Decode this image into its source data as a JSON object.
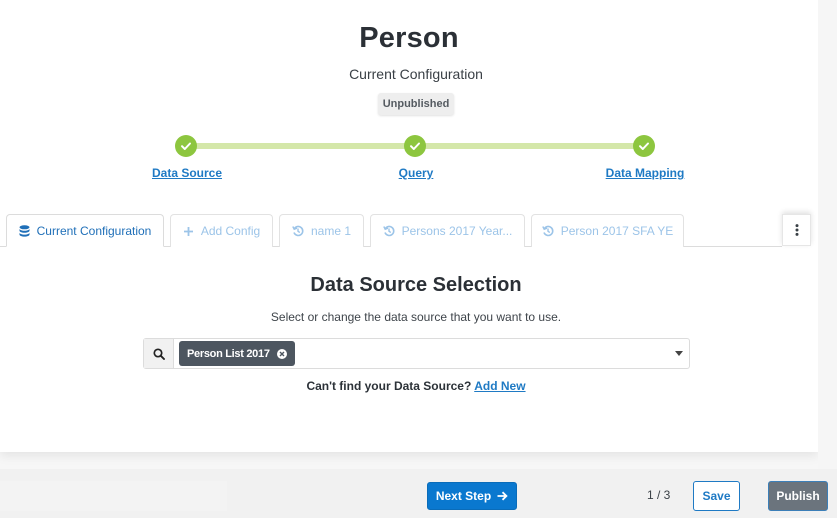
{
  "header": {
    "title": "Person",
    "subtitle": "Current Configuration",
    "status_badge": "Unpublished"
  },
  "stepper": {
    "color_complete": "#8dc63f",
    "steps": [
      {
        "label": "Data Source",
        "status": "complete"
      },
      {
        "label": "Query",
        "status": "complete"
      },
      {
        "label": "Data Mapping",
        "status": "complete"
      }
    ]
  },
  "tabs": [
    {
      "label": "Current Configuration",
      "icon": "database-icon",
      "active": true
    },
    {
      "label": "Add Config",
      "icon": "plus-icon",
      "active": false
    },
    {
      "label": "name 1",
      "icon": "history-icon",
      "active": false
    },
    {
      "label": "Persons 2017 Year...",
      "icon": "history-icon",
      "active": false
    },
    {
      "label": "Person 2017 SFA YE",
      "icon": "history-icon",
      "active": false
    }
  ],
  "tabs_menu_icon": "vertical-ellipsis-icon",
  "section": {
    "title": "Data Source Selection",
    "description": "Select or change the data source that you want to use.",
    "selected_source": "Person List 2017",
    "help_text": "Can't find your Data Source?",
    "help_link": "Add New"
  },
  "footer": {
    "next_label": "Next Step",
    "page_indicator": "1 / 3",
    "save_label": "Save",
    "publish_label": "Publish",
    "accent": "#0a78cf"
  }
}
